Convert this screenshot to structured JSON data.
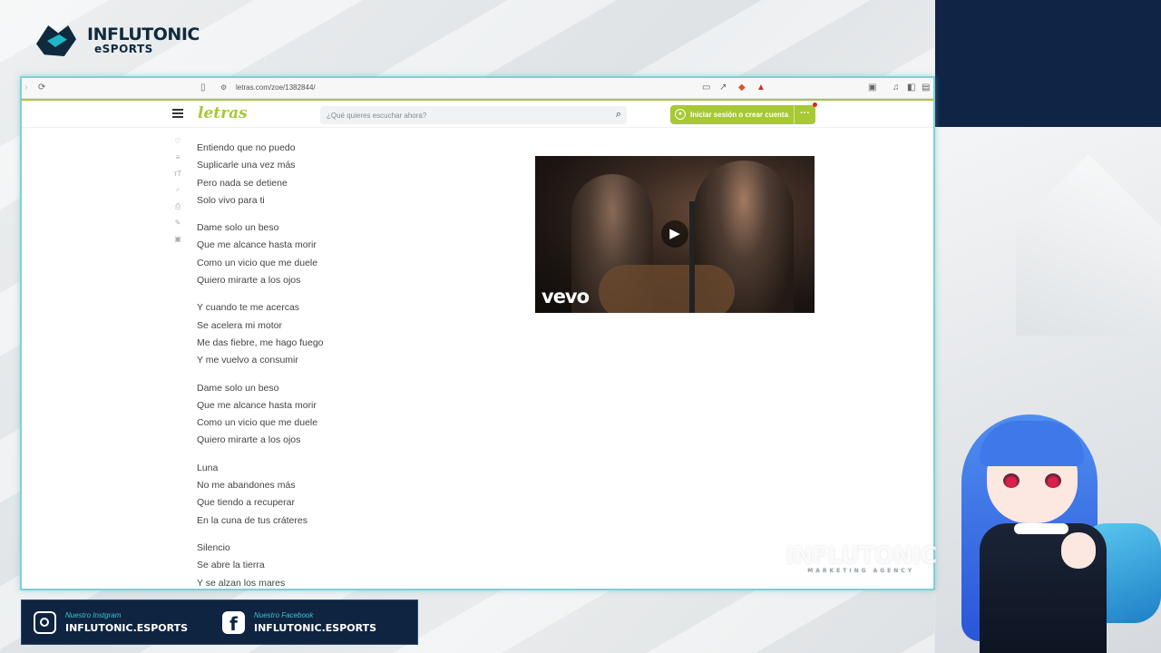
{
  "brand": {
    "line1": "INFLUTONIC",
    "line2": "eSPORTS"
  },
  "browser": {
    "url": "letras.com/zoe/1382844/",
    "site_logo": "letras",
    "search_placeholder": "¿Qué quieres escuchar ahora?",
    "login_label": "Iniciar sesión o crear cuenta",
    "more_label": "···"
  },
  "lyrics": [
    [
      "Entiendo que no puedo",
      "Suplicarle una vez más",
      "Pero nada se detiene",
      "Solo vivo para ti"
    ],
    [
      "Dame solo un beso",
      "Que me alcance hasta morir",
      "Como un vicio que me duele",
      "Quiero mirarte a los ojos"
    ],
    [
      "Y cuando te me acercas",
      "Se acelera mi motor",
      "Me das fiebre, me hago fuego",
      "Y me vuelvo a consumir"
    ],
    [
      "Dame solo un beso",
      "Que me alcance hasta morir",
      "Como un vicio que me duele",
      "Quiero mirarte a los ojos"
    ],
    [
      "Luna",
      "No me abandones más",
      "Que tiendo a recuperar",
      "En la cuna de tus cráteres"
    ],
    [
      "Silencio",
      "Se abre la tierra",
      "Y se alzan los mares"
    ]
  ],
  "video": {
    "brand": "vevo"
  },
  "watermark": {
    "main": "INFLUTONIC",
    "sub": "MARKETING AGENCY"
  },
  "social": {
    "instagram": {
      "caption": "Nuestro Instgram",
      "handle": "INFLUTONIC.ESPORTS"
    },
    "facebook": {
      "caption": "Nuestro Facebook",
      "handle": "INFLUTONIC.ESPORTS"
    }
  }
}
